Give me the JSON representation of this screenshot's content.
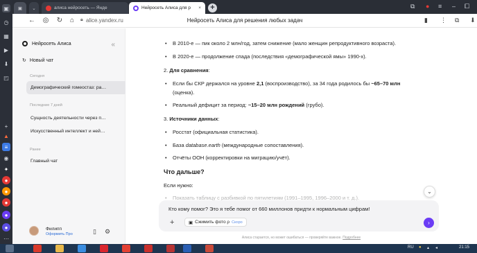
{
  "browser": {
    "tabs": [
      {
        "label": "алиса нейросеть — Янде",
        "active": false
      },
      {
        "label": "Нейросеть Алиса для р",
        "active": true
      }
    ],
    "url": "alice.yandex.ru",
    "page_title": "Нейросеть Алиса для решения любых задач"
  },
  "sidebar": {
    "app_name": "Нейросеть Алиса",
    "new_chat": "Новый чат",
    "sections": [
      {
        "label": "Сегодня",
        "items": [
          "Демографический гомеостаз: ра…"
        ]
      },
      {
        "label": "Последние 7 дней",
        "items": [
          "Сущность деятельности через п…",
          "Искусственный интеллект и ней…"
        ]
      },
      {
        "label": "Ранее",
        "items": [
          "Главный чат"
        ]
      }
    ],
    "user": {
      "name": "Филипп",
      "link": "Оформить Про"
    }
  },
  "content": {
    "bullet_2010": "В 2010-е — пик около 2 млн/год, затем снижение (мало женщин репродуктивного возраста).",
    "bullet_2020": "В 2020-е — продолжение спада (последствия «демографической ямы» 1990-х).",
    "sec2_num": "2.",
    "sec2_title": "Для сравнения",
    "cmp1_pre": "Если бы СКР держался на уровне ",
    "cmp1_b1": "2,1",
    "cmp1_mid": " (воспроизводство), за 34 года родилось бы ",
    "cmp1_b2": "~65–70 млн",
    "cmp1_post": "(оценка).",
    "cmp2_pre": "Реальный дефицит за период: ",
    "cmp2_b": "~15–20 млн рождений",
    "cmp2_post": " (грубо).",
    "sec3_num": "3.",
    "sec3_title": "Источники данных",
    "src1": "Росстат (официальная статистика).",
    "src2_em": "database.earth",
    "src2_post": " (международные сопоставления).",
    "src3": "Отчёты ООН (корректировки на миграцию/учёт).",
    "what_next": "Что дальше?",
    "if_needed": "Если нужно:",
    "faded": "Показать таблицу с разбивкой по пятилетиям (1991–1995, 1996–2000 и т. д.)."
  },
  "composer": {
    "text": "Кто кому помог? Это я тебе помог от 660 миллонов придти к нормальным цифрам!",
    "photo_chip": "Сжимить фото ρ",
    "soon": "Скоро"
  },
  "disclaimer": {
    "text": "Алиса старается, но может ошибаться — проверяйте важное.",
    "link": "Подробнее"
  },
  "taskbar": {
    "lang": "RU",
    "time": "21:15"
  },
  "colors": {
    "accent": "#6b3cf5",
    "tab_bar": "#2a2e36",
    "taskbar": "#1e3550"
  }
}
